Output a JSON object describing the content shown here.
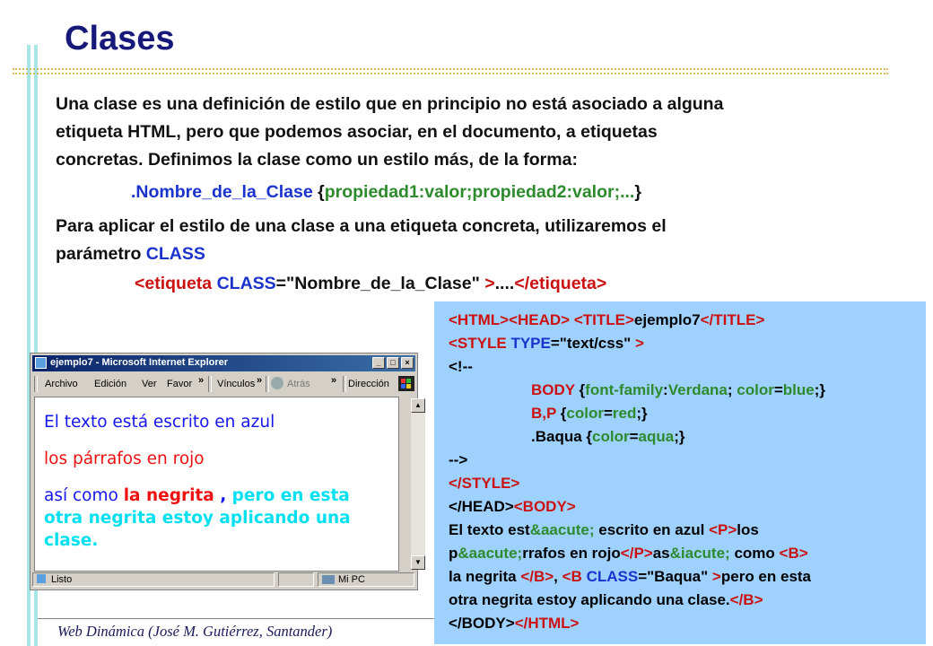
{
  "slide": {
    "title": "Clases",
    "intro_lines": [
      "Una clase es una definición de estilo que en principio no está asociado a alguna",
      "etiqueta HTML, pero que podemos asociar, en el documento, a etiquetas",
      "concretas. Definimos la clase como un estilo más, de la forma:"
    ],
    "syntax": {
      "selector": ".Nombre_de_la_Clase",
      "open": "{",
      "decl": "propiedad1:valor;propiedad2:valor;...",
      "close": "}"
    },
    "apply_lines": [
      "Para aplicar el estilo de una clase a una etiqueta concreta, utilizaremos el",
      "parámetro "
    ],
    "apply_keyword": "CLASS",
    "usage": {
      "open_tag": "<etiqueta",
      "attr": "CLASS",
      "eq_value": "=\"Nombre_de_la_Clase\"",
      "gt": ">",
      "dots": "....",
      "close_tag": "</etiqueta>"
    },
    "footer": "Web Dinámica (José M. Gutiérrez, Santander)",
    "colors": {
      "title": "#17197a",
      "accent_blue": "#1a33cc",
      "accent_green": "#2d8a2d",
      "accent_red": "#cc1111",
      "code_bg": "#9fd1ff"
    }
  },
  "browser": {
    "title": "ejemplo7 - Microsoft Internet Explorer",
    "window_buttons": [
      "_",
      "□",
      "×"
    ],
    "menu": [
      "Archivo",
      "Edición",
      "Ver",
      "Favor",
      "»",
      "Vínculos",
      "»",
      "Atrás",
      "»",
      "Dirección"
    ],
    "content": {
      "line1": "El texto está escrito en azul",
      "line2": "los párrafos en rojo",
      "line3a": "así como ",
      "line3b": "la negrita",
      "line3c": " , ",
      "line3d": "pero en esta",
      "line4": "otra negrita estoy aplicando una",
      "line5": "clase."
    },
    "status_left": "Listo",
    "status_right": "Mi PC",
    "icons": [
      "ie-logo-icon",
      "back-arrow-icon",
      "windows-flag-icon",
      "scroll-up-icon",
      "scroll-down-icon"
    ]
  },
  "code": {
    "l1": [
      "<HTML>",
      "<HEAD>",
      " ",
      "<TITLE>",
      "ejemplo7",
      "</TITLE>"
    ],
    "l2": [
      "<STYLE",
      " TYPE",
      "=\"text/css\"",
      " >"
    ],
    "l3": "<!--",
    "l4": [
      "BODY",
      " {",
      "font-family",
      ":",
      "Verdana",
      "; ",
      "color",
      "=",
      "blue",
      ";}"
    ],
    "l5": [
      "B,P",
      " {",
      "color",
      "=",
      "red",
      ";}"
    ],
    "l6": [
      ".Baqua",
      " {",
      "color",
      "=",
      "aqua",
      ";}"
    ],
    "l7": "-->",
    "l8": "</STYLE>",
    "l9": [
      "</HEAD>",
      "<BODY>"
    ],
    "l10": [
      "El texto est",
      "&aacute;",
      " escrito en azul ",
      "<P>",
      "los"
    ],
    "l11": [
      "p",
      "&aacute;",
      "rrafos en rojo",
      "</P>",
      "as",
      "&iacute;",
      " como ",
      "<B>"
    ],
    "l12": [
      "la negrita ",
      "</B>",
      ", ",
      "<B",
      " CLASS",
      "=\"Baqua\"",
      " >",
      "pero en esta"
    ],
    "l13": [
      "otra negrita estoy aplicando una clase.",
      "</B>"
    ],
    "l14": [
      "</BODY>",
      "</HTML>"
    ]
  }
}
